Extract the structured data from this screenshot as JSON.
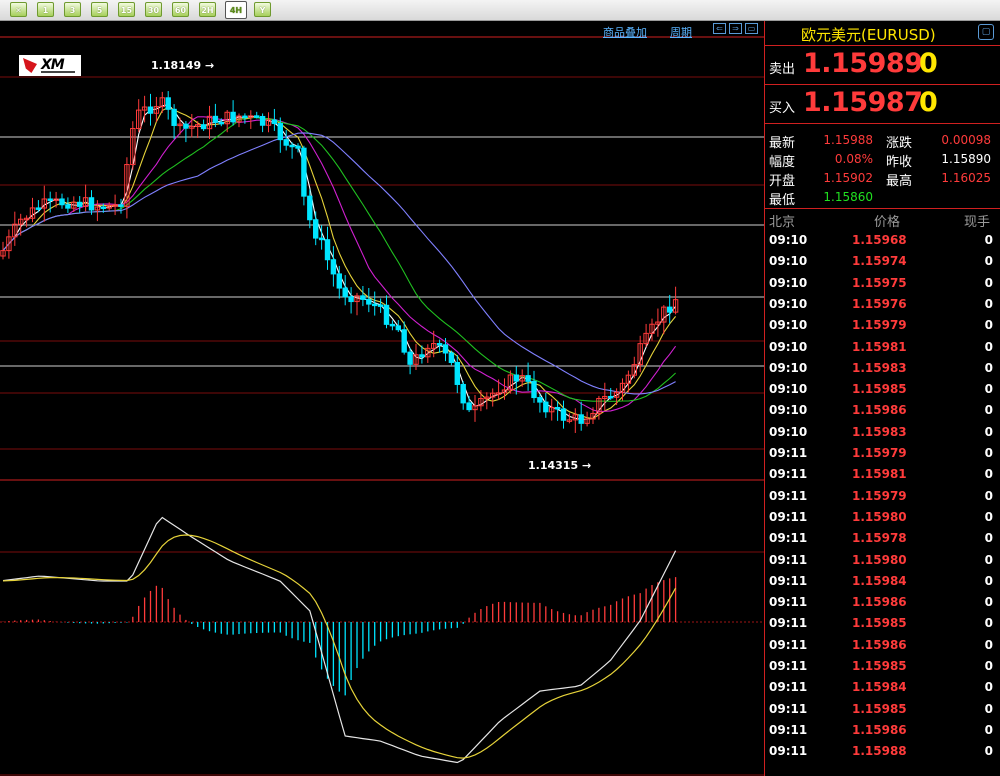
{
  "toolbar": {
    "buttons": [
      "✕",
      "1",
      "3",
      "5",
      "15",
      "30",
      "60",
      "2H",
      "4H",
      "Y"
    ]
  },
  "chart": {
    "links": {
      "overlay": "商品叠加",
      "period": "周期"
    },
    "high_label": "1.18149",
    "low_label": "1.14315",
    "colors": {
      "up": "#ff3b3b",
      "down": "#00e5ff",
      "ma1": "#ffffff",
      "ma2": "#e6d33a",
      "ma3": "#d020d0",
      "ma4": "#20c020",
      "ma5": "#8080ff"
    }
  },
  "quote": {
    "title": "欧元美元(EURUSD)",
    "sell_label": "卖出",
    "sell_price": "1.15989",
    "sell_vol": "0",
    "buy_label": "买入",
    "buy_price": "1.15987",
    "buy_vol": "0",
    "stats": {
      "latest_label": "最新",
      "latest": "1.15988",
      "change_label": "涨跌",
      "change": "0.00098",
      "range_label": "幅度",
      "range": "0.08%",
      "prevclose_label": "昨收",
      "prevclose": "1.15890",
      "open_label": "开盘",
      "open": "1.15902",
      "high_label": "最高",
      "high": "1.16025",
      "low_label": "最低",
      "low": "1.15860"
    },
    "headers": {
      "time": "北京",
      "price": "价格",
      "vol": "现手"
    },
    "ticks": [
      {
        "t": "09:10",
        "p": "1.15968",
        "v": "0"
      },
      {
        "t": "09:10",
        "p": "1.15974",
        "v": "0"
      },
      {
        "t": "09:10",
        "p": "1.15975",
        "v": "0"
      },
      {
        "t": "09:10",
        "p": "1.15976",
        "v": "0"
      },
      {
        "t": "09:10",
        "p": "1.15979",
        "v": "0"
      },
      {
        "t": "09:10",
        "p": "1.15981",
        "v": "0"
      },
      {
        "t": "09:10",
        "p": "1.15983",
        "v": "0"
      },
      {
        "t": "09:10",
        "p": "1.15985",
        "v": "0"
      },
      {
        "t": "09:10",
        "p": "1.15986",
        "v": "0"
      },
      {
        "t": "09:10",
        "p": "1.15983",
        "v": "0"
      },
      {
        "t": "09:11",
        "p": "1.15979",
        "v": "0"
      },
      {
        "t": "09:11",
        "p": "1.15981",
        "v": "0"
      },
      {
        "t": "09:11",
        "p": "1.15979",
        "v": "0"
      },
      {
        "t": "09:11",
        "p": "1.15980",
        "v": "0"
      },
      {
        "t": "09:11",
        "p": "1.15978",
        "v": "0"
      },
      {
        "t": "09:11",
        "p": "1.15980",
        "v": "0"
      },
      {
        "t": "09:11",
        "p": "1.15984",
        "v": "0"
      },
      {
        "t": "09:11",
        "p": "1.15986",
        "v": "0"
      },
      {
        "t": "09:11",
        "p": "1.15985",
        "v": "0"
      },
      {
        "t": "09:11",
        "p": "1.15986",
        "v": "0"
      },
      {
        "t": "09:11",
        "p": "1.15985",
        "v": "0"
      },
      {
        "t": "09:11",
        "p": "1.15984",
        "v": "0"
      },
      {
        "t": "09:11",
        "p": "1.15985",
        "v": "0"
      },
      {
        "t": "09:11",
        "p": "1.15986",
        "v": "0"
      },
      {
        "t": "09:11",
        "p": "1.15988",
        "v": "0"
      }
    ]
  }
}
